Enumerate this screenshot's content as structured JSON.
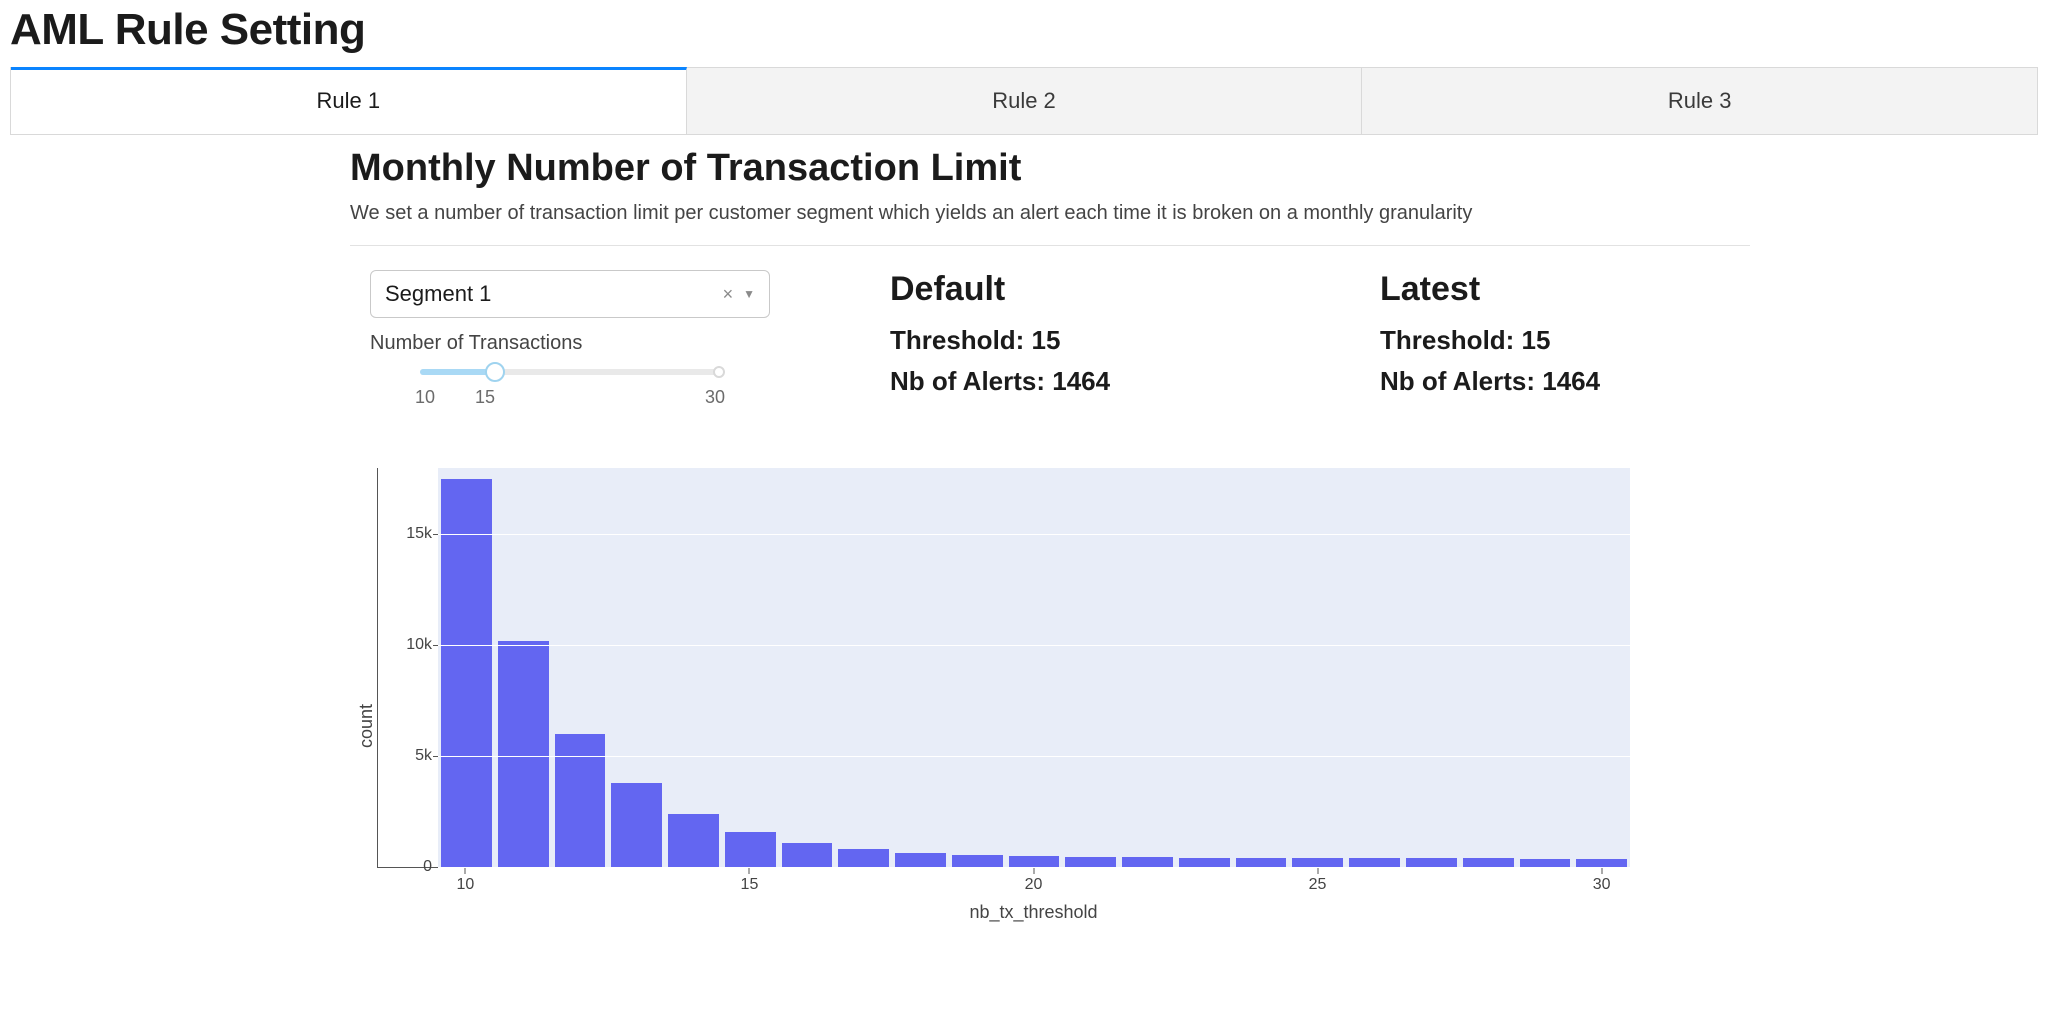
{
  "page_title": "AML Rule Setting",
  "tabs": [
    {
      "label": "Rule 1",
      "active": true
    },
    {
      "label": "Rule 2",
      "active": false
    },
    {
      "label": "Rule 3",
      "active": false
    }
  ],
  "section": {
    "title": "Monthly Number of Transaction Limit",
    "description": "We set a number of transaction limit per customer segment which yields an alert each time it is broken on a monthly granularity"
  },
  "segment_select": {
    "selected": "Segment 1"
  },
  "slider": {
    "label": "Number of Transactions",
    "min": 10,
    "max": 30,
    "value": 15,
    "min_label": "10",
    "max_label": "30",
    "value_label": "15"
  },
  "default_block": {
    "title": "Default",
    "threshold_label": "Threshold: 15",
    "alerts_label": "Nb of Alerts: 1464"
  },
  "latest_block": {
    "title": "Latest",
    "threshold_label": "Threshold: 15",
    "alerts_label": "Nb of Alerts: 1464"
  },
  "chart_data": {
    "type": "bar",
    "xlabel": "nb_tx_threshold",
    "ylabel": "count",
    "x": [
      10,
      11,
      12,
      13,
      14,
      15,
      16,
      17,
      18,
      19,
      20,
      21,
      22,
      23,
      24,
      25,
      26,
      27,
      28,
      29,
      30
    ],
    "values": [
      17500,
      10200,
      6000,
      3800,
      2400,
      1600,
      1100,
      800,
      650,
      550,
      500,
      450,
      430,
      420,
      410,
      400,
      395,
      390,
      385,
      380,
      375
    ],
    "ylim": [
      0,
      18000
    ],
    "y_ticks": [
      0,
      5000,
      10000,
      15000
    ],
    "y_tick_labels": [
      "0",
      "5k",
      "10k",
      "15k"
    ],
    "x_ticks": [
      10,
      15,
      20,
      25,
      30
    ],
    "x_tick_labels": [
      "10",
      "15",
      "20",
      "25",
      "30"
    ]
  }
}
